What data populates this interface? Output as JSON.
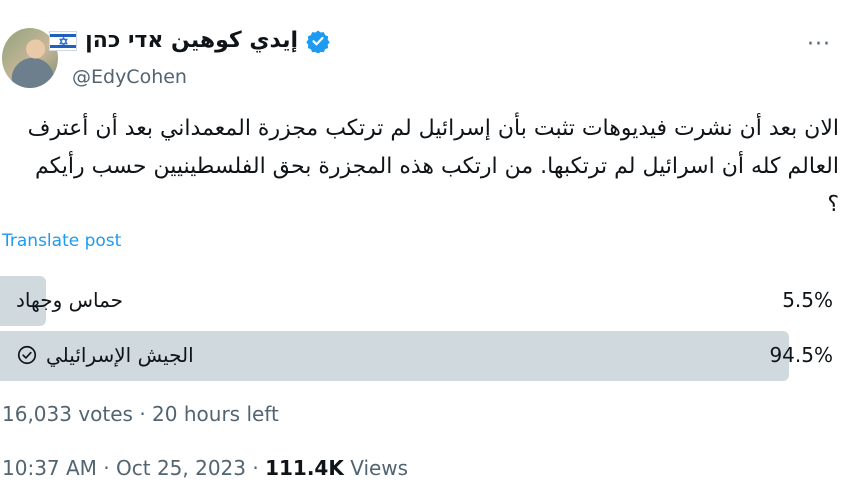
{
  "author": {
    "display_name": "إيدي كوهين אדי כהן",
    "handle": "@EdyCohen",
    "verified_icon": "verified-badge-icon",
    "flag_icon": "israel-flag-icon",
    "avatar_icon": "profile-photo"
  },
  "more_icon": "···",
  "tweet": {
    "text": "الان بعد أن نشرت فيديوهات تثبت بأن إسرائيل لم ترتكب مجزرة المعمداني بعد أن أعترف العالم كله أن اسرائيل لم ترتكبها. من ارتكب هذه المجزرة بحق الفلسطينيين حسب رأيكم ؟"
  },
  "translate_link": "Translate post",
  "poll": {
    "options": [
      {
        "label": "حماس وجهاد",
        "percent": "5.5%",
        "share": 0.055,
        "selected": false
      },
      {
        "label": "الجيش الإسرائيلي",
        "percent": "94.5%",
        "share": 0.945,
        "selected": true
      }
    ],
    "summary": "16,033 votes · 20 hours left"
  },
  "footer": {
    "timestamp": "10:37 AM · Oct 25, 2023 · ",
    "views_count": "111.4K",
    "views_label": " Views"
  },
  "colors": {
    "accent": "#1d9bf0",
    "poll_bar": "#cfd9de",
    "secondary_text": "#536471"
  }
}
